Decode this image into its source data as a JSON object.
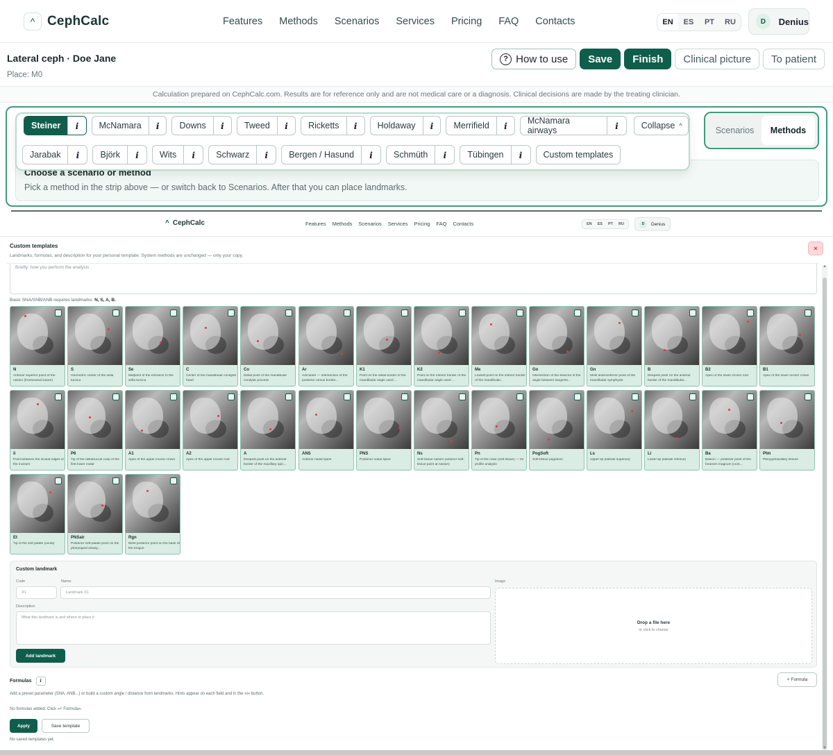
{
  "brand": {
    "name": "CephCalc",
    "logo_glyph": "^"
  },
  "nav": [
    "Features",
    "Methods",
    "Scenarios",
    "Services",
    "Pricing",
    "FAQ",
    "Contacts"
  ],
  "languages": [
    {
      "code": "EN",
      "active": true
    },
    {
      "code": "ES",
      "active": false
    },
    {
      "code": "PT",
      "active": false
    },
    {
      "code": "RU",
      "active": false
    }
  ],
  "user": {
    "initial": "D",
    "name": "Denius"
  },
  "record": {
    "title": "Lateral ceph · Doe Jane",
    "place": "Place: M0"
  },
  "actions": {
    "how_to_use": "How to use",
    "how_icon": "?",
    "save": "Save",
    "finish": "Finish",
    "clinical_picture": "Clinical picture",
    "to_patient": "To patient"
  },
  "disclaimer": "Calculation prepared on CephCalc.com. Results are for reference only and are not medical care or a diagnosis. Clinical decisions are made by the treating clinician.",
  "methods_row1": [
    {
      "label": "Steiner",
      "active": true
    },
    {
      "label": "McNamara"
    },
    {
      "label": "Downs"
    },
    {
      "label": "Tweed"
    },
    {
      "label": "Ricketts"
    },
    {
      "label": "Holdaway"
    },
    {
      "label": "Merrifield"
    },
    {
      "label": "McNamara airways"
    }
  ],
  "methods_row2": [
    {
      "label": "Jarabak"
    },
    {
      "label": "Björk"
    },
    {
      "label": "Wits"
    },
    {
      "label": "Schwarz"
    },
    {
      "label": "Bergen / Hasund"
    },
    {
      "label": "Schmüth"
    },
    {
      "label": "Tübingen"
    }
  ],
  "info_glyph": "i",
  "collapse_label": "Collapse",
  "collapse_icon": "^",
  "custom_templates_label": "Custom templates",
  "placeholder": {
    "title": "Choose a scenario or method",
    "text": "Pick a method in the strip above — or switch back to Scenarios. After that you can place landmarks."
  },
  "mode_toggle": {
    "scenarios": "Scenarios",
    "methods": "Methods",
    "active": "methods"
  },
  "custom": {
    "title": "Custom templates",
    "subtitle": "Landmarks, formulas, and description for your personal template. System methods are unchanged — only your copy.",
    "close_icon": "×",
    "brief_placeholder": "Briefly: how you perform the analysis",
    "requires_prefix": "Basic SNA/SNB/ANB requires landmarks:",
    "requires_points": "N, S, A, B.",
    "landmarks": [
      {
        "code": "N",
        "desc": "Anterior superior point of the nasion (frontonasal suture)"
      },
      {
        "code": "S",
        "desc": "Geometric center of the sella turcica"
      },
      {
        "code": "Se",
        "desc": "Midpoint of the entrance to the sella turcica"
      },
      {
        "code": "C",
        "desc": "Center of the mandibular condylar head"
      },
      {
        "code": "Co",
        "desc": "Distal point of the mandibular condylar process"
      },
      {
        "code": "Ar",
        "desc": "Articulare — intersection of the posterior ramus border..."
      },
      {
        "code": "K1",
        "desc": "Point on the distal border of the mandibular angle used ..."
      },
      {
        "code": "K2",
        "desc": "Point on the inferior border of the mandibular angle used ..."
      },
      {
        "code": "Me",
        "desc": "Lowest point on the inferior border of the mandibular..."
      },
      {
        "code": "Go",
        "desc": "Intersection of the bisector of the angle between tangents..."
      },
      {
        "code": "Gn",
        "desc": "Most anteroinferior point of the mandibular symphysis"
      },
      {
        "code": "B",
        "desc": "Deepest point on the anterior border of the mandibular..."
      },
      {
        "code": "B2",
        "desc": "Apex of the lower incisor root"
      },
      {
        "code": "B1",
        "desc": "Apex of the lower incisor crown"
      },
      {
        "code": "ii",
        "desc": "Point between the incisal edges of the incisors"
      },
      {
        "code": "P6",
        "desc": "Tip of the distobuccal cusp of the first lower molar"
      },
      {
        "code": "A1",
        "desc": "Apex of the upper incisor crown"
      },
      {
        "code": "A2",
        "desc": "Apex of the upper incisor root"
      },
      {
        "code": "A",
        "desc": "Deepest point on the anterior border of the maxillary apic..."
      },
      {
        "code": "ANS",
        "desc": "Anterior nasal spine"
      },
      {
        "code": "PNS",
        "desc": "Posterior nasal spine"
      },
      {
        "code": "Ns",
        "desc": "Soft-tissue nasion (anterior soft-tissue point at nasion)"
      },
      {
        "code": "Pn",
        "desc": "Tip of the nose (soft tissue) — for profile analysis"
      },
      {
        "code": "PogSoft",
        "desc": "Soft-tissue pogonion"
      },
      {
        "code": "Ls",
        "desc": "Upper lip (labrale superius)"
      },
      {
        "code": "Li",
        "desc": "Lower lip (labrale inferius)"
      },
      {
        "code": "Ba",
        "desc": "Basion — posterior point of the foramen magnum (cont..."
      },
      {
        "code": "Ptm",
        "desc": "Pterygomaxillary fissure"
      },
      {
        "code": "Et",
        "desc": "Tip of the soft palate (uvula)"
      },
      {
        "code": "PNSair",
        "desc": "Posterior soft-palate point on the pharyngeal airway..."
      },
      {
        "code": "Rgn",
        "desc": "Most posterior point on the base of the tongue"
      }
    ],
    "custom_landmark": {
      "title": "Custom landmark",
      "code_label": "Code",
      "code_placeholder": "X1",
      "name_label": "Name",
      "name_placeholder": "Landmark X1",
      "desc_label": "Description",
      "desc_placeholder": "What this landmark is and where to place it",
      "image_label": "Image",
      "drop_title": "Drop a file here",
      "drop_sub": "or click to choose",
      "add_button": "Add landmark"
    },
    "formulas": {
      "title": "Formulas",
      "add_button": "+ Formula",
      "hint": "Add a preset parameter (SNA, ANB...) or build a custom angle / distance from landmarks. Hints appear on each field and in the «i» button.",
      "empty": "No formulas added. Click «+ Formula».",
      "apply": "Apply",
      "save_template": "Save template",
      "no_saved": "No saved templates yet."
    }
  },
  "colors": {
    "accent": "#0f5e4c",
    "accent_border": "#3f9a7d",
    "danger": "#c9323f"
  }
}
